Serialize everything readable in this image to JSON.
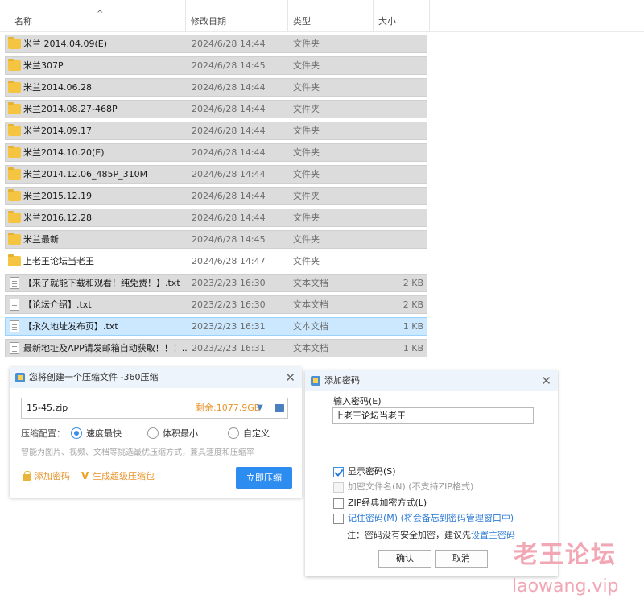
{
  "explorer": {
    "columns": {
      "name": "名称",
      "date": "修改日期",
      "type": "类型",
      "size": "大小"
    },
    "sort_icon": "^",
    "rows": [
      {
        "name": "米兰 2014.04.09(E)",
        "date": "2024/6/28 14:44",
        "type": "文件夹",
        "size": "",
        "icon": "folder-icon"
      },
      {
        "name": "米兰307P",
        "date": "2024/6/28 14:45",
        "type": "文件夹",
        "size": "",
        "icon": "folder-icon"
      },
      {
        "name": "米兰2014.06.28",
        "date": "2024/6/28 14:44",
        "type": "文件夹",
        "size": "",
        "icon": "folder-icon"
      },
      {
        "name": "米兰2014.08.27-468P",
        "date": "2024/6/28 14:44",
        "type": "文件夹",
        "size": "",
        "icon": "folder-icon"
      },
      {
        "name": "米兰2014.09.17",
        "date": "2024/6/28 14:44",
        "type": "文件夹",
        "size": "",
        "icon": "folder-icon"
      },
      {
        "name": "米兰2014.10.20(E)",
        "date": "2024/6/28 14:44",
        "type": "文件夹",
        "size": "",
        "icon": "folder-icon"
      },
      {
        "name": "米兰2014.12.06_485P_310M",
        "date": "2024/6/28 14:44",
        "type": "文件夹",
        "size": "",
        "icon": "folder-icon"
      },
      {
        "name": "米兰2015.12.19",
        "date": "2024/6/28 14:44",
        "type": "文件夹",
        "size": "",
        "icon": "folder-icon"
      },
      {
        "name": "米兰2016.12.28",
        "date": "2024/6/28 14:44",
        "type": "文件夹",
        "size": "",
        "icon": "folder-icon"
      },
      {
        "name": "米兰最新",
        "date": "2024/6/28 14:45",
        "type": "文件夹",
        "size": "",
        "icon": "folder-icon"
      },
      {
        "name": "上老王论坛当老王",
        "date": "2024/6/28 14:47",
        "type": "文件夹",
        "size": "",
        "icon": "folder-icon"
      },
      {
        "name": "【来了就能下载和观看！纯免费！】.txt",
        "date": "2023/2/23 16:30",
        "type": "文本文档",
        "size": "2 KB",
        "icon": "text-file-icon"
      },
      {
        "name": "【论坛介绍】.txt",
        "date": "2023/2/23 16:30",
        "type": "文本文档",
        "size": "2 KB",
        "icon": "text-file-icon"
      },
      {
        "name": "【永久地址发布页】.txt",
        "date": "2023/2/23 16:31",
        "type": "文本文档",
        "size": "1 KB",
        "icon": "text-file-icon",
        "selected": true
      },
      {
        "name": "最新地址及APP请发邮箱自动获取！！！....",
        "date": "2023/2/23 16:31",
        "type": "文本文档",
        "size": "1 KB",
        "icon": "text-file-icon"
      }
    ]
  },
  "compress_dialog": {
    "title": "您将创建一个压缩文件 -360压缩",
    "close_glyph": "✕",
    "filename": "15-45.zip",
    "free_space": "剩余:1077.9GB",
    "dropdown_glyph": "▼",
    "config_label": "压缩配置：",
    "options": [
      "速度最快",
      "体积最小",
      "自定义"
    ],
    "selected_option": "速度最快",
    "hint": "智能为图片、视频、文档等挑选最优压缩方式，兼具速度和压缩率",
    "add_password": "添加密码",
    "super_pack_glyph": "V",
    "super_pack": "生成超级压缩包",
    "compress_button": "立即压缩"
  },
  "password_dialog": {
    "title": "添加密码",
    "close_glyph": "✕",
    "input_label": "输入密码(E)",
    "password_value": "上老王论坛当老王",
    "show_password": {
      "label": "显示密码(S)",
      "checked": true
    },
    "encrypt_filenames": {
      "label": "加密文件名(N) (不支持ZIP格式)",
      "checked": false,
      "disabled": true
    },
    "zip_classic": {
      "label": "ZIP经典加密方式(L)",
      "checked": false
    },
    "remember_password": {
      "label": "记住密码(M) (将会备忘到密码管理窗口中)",
      "checked": false
    },
    "note_prefix": "注：密码没有安全加密，建议先",
    "note_link": "设置主密码",
    "ok_button": "确认",
    "cancel_button": "取消"
  },
  "watermark": {
    "title": "老王论坛",
    "url": "laowang.vip"
  },
  "colors": {
    "selected_row": "#cce8ff",
    "row_highlight": "#dcdcdc",
    "accent_blue": "#2d8cf0",
    "orange": "#e8942a",
    "watermark": "#f2a7b4"
  }
}
